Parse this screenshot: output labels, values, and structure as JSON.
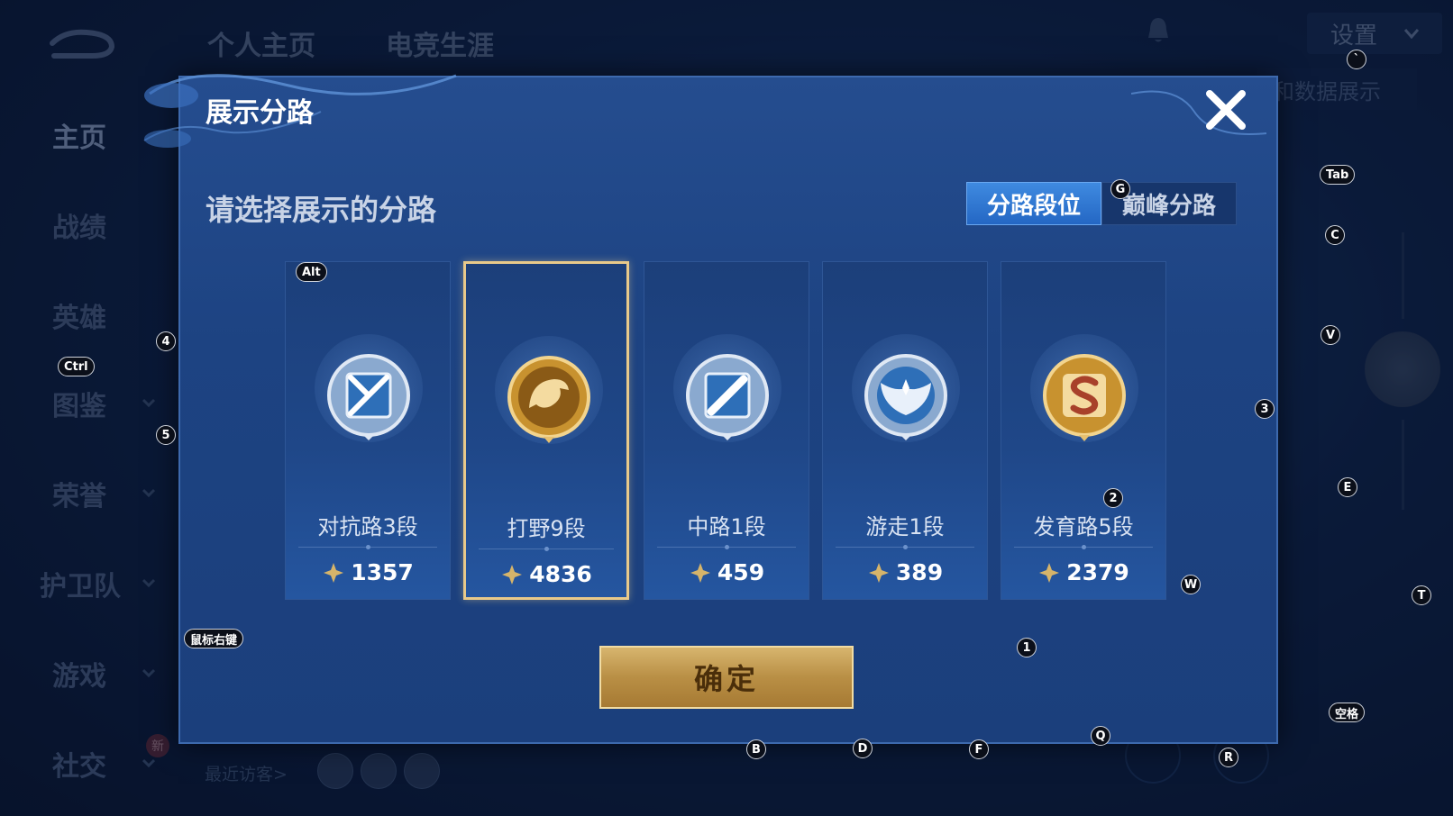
{
  "header": {
    "tabs": [
      "个人主页",
      "电竞生涯"
    ],
    "settings_label": "设置",
    "faded_right_text": "和数据展示"
  },
  "sidebar": {
    "items": [
      {
        "label": "主页"
      },
      {
        "label": "战绩"
      },
      {
        "label": "英雄"
      },
      {
        "label": "图鉴"
      },
      {
        "label": "荣誉"
      },
      {
        "label": "护卫队"
      },
      {
        "label": "游戏"
      },
      {
        "label": "社交"
      }
    ]
  },
  "footer": {
    "recent_visitors": "最近访客>",
    "new_badge": "新"
  },
  "dialog": {
    "title": "展示分路",
    "subtitle": "请选择展示的分路",
    "segments": [
      "分路段位",
      "巅峰分路"
    ],
    "cards": [
      {
        "name": "对抗路3段",
        "score": "1357",
        "emblem": "silver-crossed-blades-emblem-icon",
        "selected": false
      },
      {
        "name": "打野9段",
        "score": "4836",
        "emblem": "gold-dragon-emblem-icon",
        "selected": true
      },
      {
        "name": "中路1段",
        "score": "459",
        "emblem": "silver-slash-emblem-icon",
        "selected": false
      },
      {
        "name": "游走1段",
        "score": "389",
        "emblem": "silver-wings-emblem-icon",
        "selected": false
      },
      {
        "name": "发育路5段",
        "score": "2379",
        "emblem": "gold-s-emblem-icon",
        "selected": false
      }
    ],
    "confirm_label": "确定"
  },
  "key_hints": {
    "alt": "Alt",
    "ctrl": "Ctrl",
    "tab": "Tab",
    "mouse_right": "鼠标右键",
    "space": "空格",
    "g": "G",
    "c": "C",
    "v": "V",
    "e": "E",
    "t": "T",
    "w": "W",
    "q": "Q",
    "r": "R",
    "b": "B",
    "d": "D",
    "f": "F",
    "backtick": "`",
    "n1": "1",
    "n2": "2",
    "n3": "3",
    "n4": "4",
    "n5": "5"
  },
  "colors": {
    "accent_gold": "#e8c98a",
    "dialog_bg": "#1d4382",
    "active_segment": "#2f7ad6"
  }
}
